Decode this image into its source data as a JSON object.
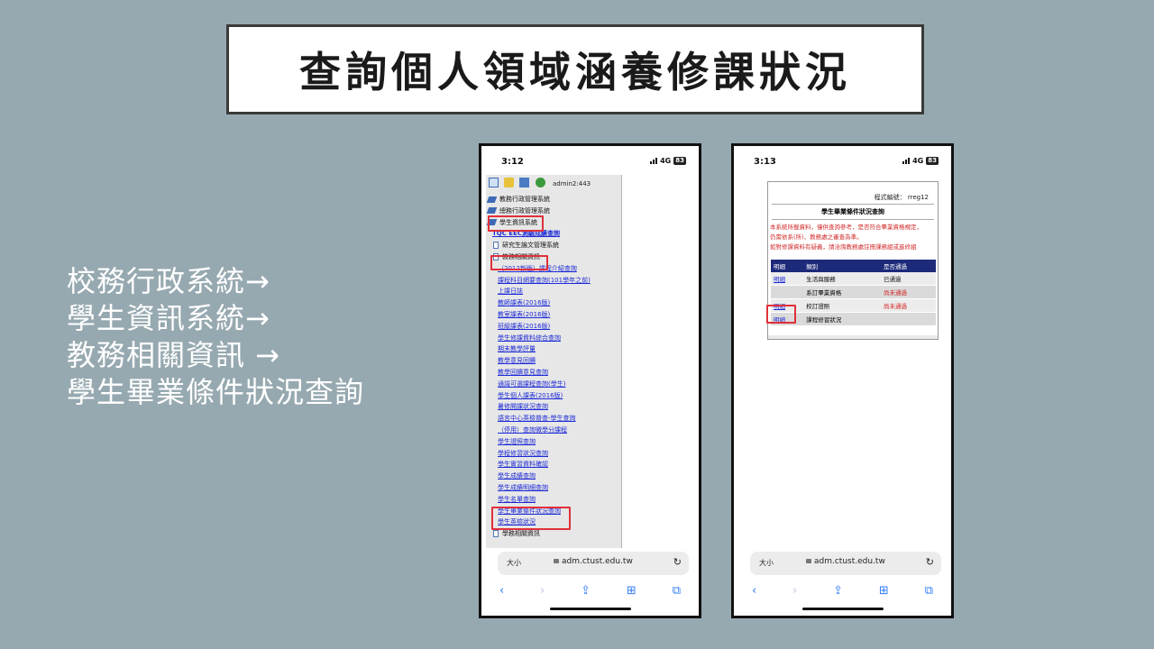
{
  "slide": {
    "title": "查詢個人領域涵養修課狀況",
    "steps": [
      "校務行政系統→",
      "學生資訊系統→",
      "教務相關資訊 →",
      "學生畢業條件狀況查詢"
    ]
  },
  "phone_left": {
    "time": "3:12",
    "network": "4G",
    "battery": "83",
    "user": "admin2:443",
    "menu": [
      {
        "label": "教務行政管理系統",
        "kind": "folder"
      },
      {
        "label": "總務行政管理系統",
        "kind": "folder"
      },
      {
        "label": "學生資訊系統",
        "kind": "folder"
      },
      {
        "label": "TQC EEC測驗成績查詢",
        "kind": "link-strong"
      },
      {
        "label": "研究生論文管理系統",
        "kind": "doc"
      },
      {
        "label": "教務相關資訊",
        "kind": "doc"
      },
      {
        "label": "（2012新版）課程介紹查詢",
        "kind": "link"
      },
      {
        "label": "課程科目網要查詢(101學年之前)",
        "kind": "link"
      },
      {
        "label": "上課日誌",
        "kind": "link"
      },
      {
        "label": "教師課表(2016版)",
        "kind": "link"
      },
      {
        "label": "教室課表(2016版)",
        "kind": "link"
      },
      {
        "label": "班級課表(2016版)",
        "kind": "link"
      },
      {
        "label": "學生修課資料綜合查詢",
        "kind": "link"
      },
      {
        "label": "期末教學評量",
        "kind": "link"
      },
      {
        "label": "教學意見回饋",
        "kind": "link"
      },
      {
        "label": "教學回饋意見查詢",
        "kind": "link"
      },
      {
        "label": "通識可選課程查詢(學生)",
        "kind": "link"
      },
      {
        "label": "學生個人課表(2016版)",
        "kind": "link"
      },
      {
        "label": "暑修開課狀況查詢",
        "kind": "link"
      },
      {
        "label": "語言中心英檢普查-學生查詢",
        "kind": "link"
      },
      {
        "label": "（停用）查詢微學分課程",
        "kind": "link"
      },
      {
        "label": "學生證照查詢",
        "kind": "link"
      },
      {
        "label": "學程修習狀況查詢",
        "kind": "link"
      },
      {
        "label": "學生實習資料確認",
        "kind": "link"
      },
      {
        "label": "學生成績查詢",
        "kind": "link"
      },
      {
        "label": "學生成績明細查詢",
        "kind": "link"
      },
      {
        "label": "學生名單查詢",
        "kind": "link"
      },
      {
        "label": "學生畢業條件狀況查詢",
        "kind": "link"
      },
      {
        "label": "學生英檢狀況",
        "kind": "link"
      },
      {
        "label": "學務相關資訊",
        "kind": "doc"
      }
    ],
    "url": {
      "aa": "大小",
      "domain": "adm.ctust.edu.tw",
      "reload": "↻"
    },
    "nav": [
      "‹",
      "›",
      "⇪",
      "⊞",
      "⧉"
    ]
  },
  "phone_right": {
    "time": "3:13",
    "network": "4G",
    "battery": "83",
    "program_code": "程式編號： rreg12",
    "report_title": "學生畢業條件狀況查詢",
    "notes": [
      "本系統所載資料，僅供查詢參考，是否符合畢業資格規定，",
      "仍需依系(所)、教務處之審查為準。",
      "如對修課資料有疑義，請洽詢教務處註冊課務組或進修組"
    ],
    "table": {
      "headers": [
        "明細",
        "類別",
        "是否通過"
      ],
      "rows": [
        {
          "detail": "明細",
          "category": "生活與服務",
          "status": "已通過",
          "state": "pass"
        },
        {
          "detail": "",
          "category": "系訂畢業資格",
          "status": "尚未通過",
          "state": "fail"
        },
        {
          "detail": "明細",
          "category": "校訂證照",
          "status": "尚未通過",
          "state": "fail"
        },
        {
          "detail": "明細",
          "category": "課程修習狀況",
          "status": "",
          "state": "pass"
        }
      ]
    },
    "url": {
      "aa": "大小",
      "domain": "adm.ctust.edu.tw",
      "reload": "↻"
    },
    "nav": [
      "‹",
      "›",
      "⇪",
      "⊞",
      "⧉"
    ]
  },
  "colors": {
    "background": "#97a9b0",
    "highlight": "#e0303a",
    "link": "#1c2ad6",
    "fail": "#d42323",
    "table_header": "#1d2a7a"
  }
}
